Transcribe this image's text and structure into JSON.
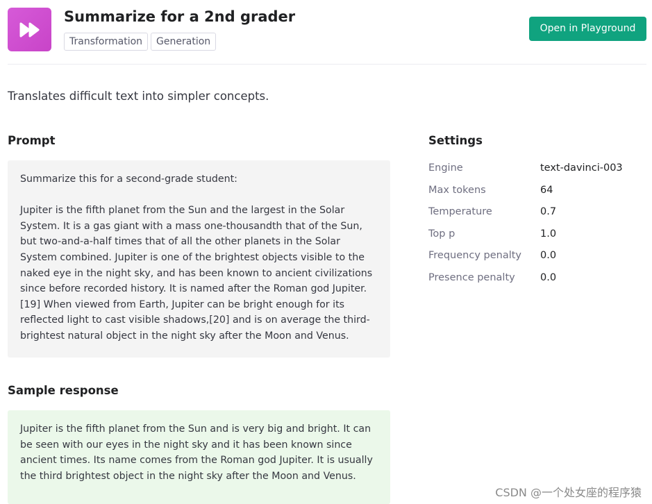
{
  "header": {
    "icon": "fast-forward-icon",
    "title": "Summarize for a 2nd grader",
    "tags": [
      "Transformation",
      "Generation"
    ],
    "open_button_label": "Open in Playground"
  },
  "description": "Translates difficult text into simpler concepts.",
  "prompt": {
    "heading": "Prompt",
    "paragraphs": [
      "Summarize this for a second-grade student:",
      "Jupiter is the fifth planet from the Sun and the largest in the Solar System. It is a gas giant with a mass one-thousandth that of the Sun, but two-and-a-half times that of all the other planets in the Solar System combined. Jupiter is one of the brightest objects visible to the naked eye in the night sky, and has been known to ancient civilizations since before recorded history. It is named after the Roman god Jupiter.[19] When viewed from Earth, Jupiter can be bright enough for its reflected light to cast visible shadows,[20] and is on average the third-brightest natural object in the night sky after the Moon and Venus."
    ]
  },
  "sample_response": {
    "heading": "Sample response",
    "text": "Jupiter is the fifth planet from the Sun and is very big and bright. It can be seen with our eyes in the night sky and it has been known since ancient times. Its name comes from the Roman god Jupiter. It is usually the third brightest object in the night sky after the Moon and Venus."
  },
  "settings": {
    "heading": "Settings",
    "rows": [
      {
        "label": "Engine",
        "value": "text-davinci-003"
      },
      {
        "label": "Max tokens",
        "value": "64"
      },
      {
        "label": "Temperature",
        "value": "0.7"
      },
      {
        "label": "Top p",
        "value": "1.0"
      },
      {
        "label": "Frequency penalty",
        "value": "0.0"
      },
      {
        "label": "Presence penalty",
        "value": "0.0"
      }
    ]
  },
  "watermark": "CSDN @一个处女座的程序猿",
  "colors": {
    "accent": "#10a37f",
    "icon_gradient_start": "#d65ad8",
    "icon_gradient_end": "#c844c8",
    "prompt_bg": "#f4f4f4",
    "response_bg": "#ebf8ea"
  }
}
